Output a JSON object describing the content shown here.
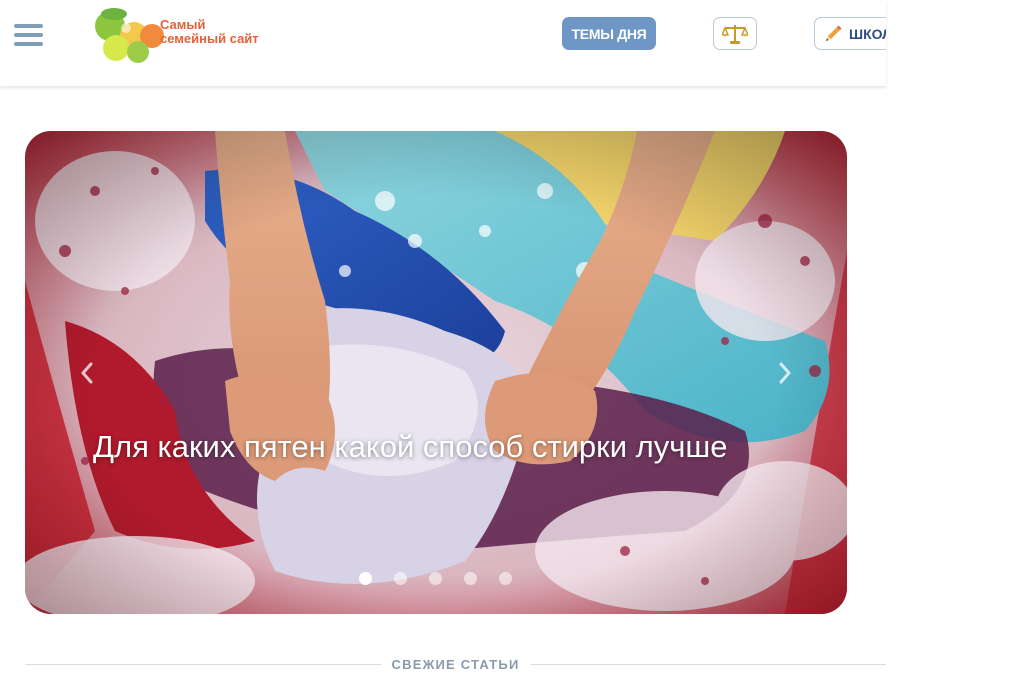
{
  "header": {
    "logo_text_line1": "Самый",
    "logo_text_line2": "семейный сайт",
    "topics_button_label": "ТЕМЫ ДНЯ",
    "school_button_label": "ШКОЛ",
    "menu_icon": "hamburger-icon",
    "scales_icon": "scales-icon",
    "pencil_icon": "pencil-icon"
  },
  "slider": {
    "title": "Для каких пятен какой способ стирки лучше",
    "slide_count": 5,
    "active_slide": 1,
    "prev_icon": "chevron-left-icon",
    "next_icon": "chevron-right-icon"
  },
  "section": {
    "heading": "СВЕЖИЕ СТАТЬИ"
  },
  "colors": {
    "accent_blue": "#6f97c5",
    "logo_orange": "#e8603a",
    "menu_icon": "#7f9fb7",
    "section_label": "#8a9aac"
  }
}
